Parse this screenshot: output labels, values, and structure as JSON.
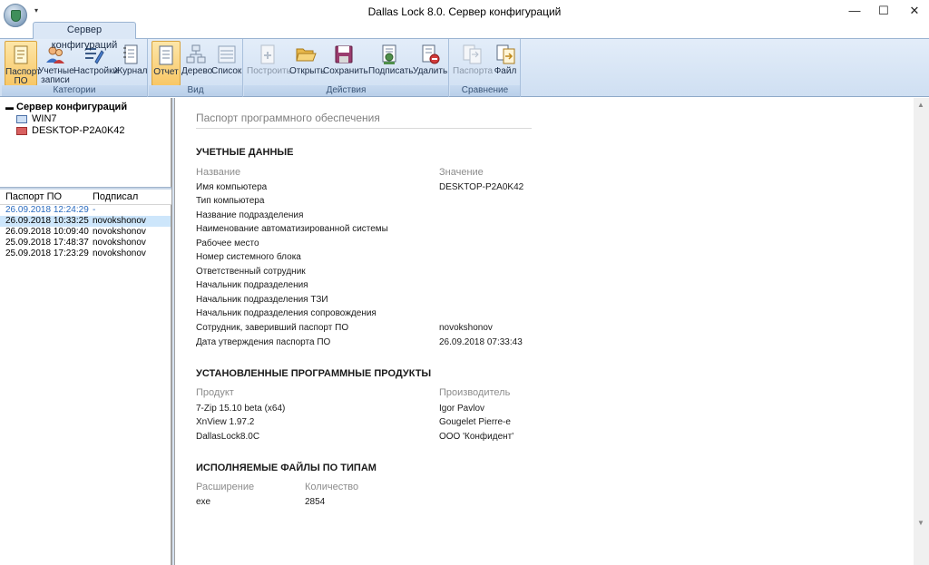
{
  "window": {
    "title": "Dallas Lock 8.0. Сервер конфигураций",
    "minimize": "—",
    "maximize": "☐",
    "close": "✕",
    "quick_access": "▾"
  },
  "ribbon": {
    "tab": "Сервер конфигураций",
    "groups": {
      "categories": {
        "label": "Категории",
        "passport": "Паспорт ПО",
        "accounts": "Учетные записи",
        "settings": "Настройки",
        "journal": "Журнал"
      },
      "view": {
        "label": "Вид",
        "report": "Отчет",
        "tree": "Дерево",
        "list": "Список"
      },
      "actions": {
        "label": "Действия",
        "build": "Построить",
        "open": "Открыть",
        "save": "Сохранить",
        "sign": "Подписать",
        "delete": "Удалить"
      },
      "compare": {
        "label": "Сравнение",
        "passport": "Паспорта",
        "file": "Файл"
      }
    }
  },
  "tree": {
    "root": "Сервер конфигураций",
    "items": [
      "WIN7",
      "DESKTOP-P2A0K42"
    ]
  },
  "passports": {
    "columns": [
      "Паспорт ПО",
      "Подписал"
    ],
    "rows": [
      {
        "date": "26.09.2018 12:24:29",
        "signer": "-"
      },
      {
        "date": "26.09.2018 10:33:25",
        "signer": "novokshonov"
      },
      {
        "date": "26.09.2018 10:09:40",
        "signer": "novokshonov"
      },
      {
        "date": "25.09.2018 17:48:37",
        "signer": "novokshonov"
      },
      {
        "date": "25.09.2018 17:23:29",
        "signer": "novokshonov"
      }
    ]
  },
  "report": {
    "title": "Паспорт программного обеспечения",
    "credentials": {
      "heading": "УЧЕТНЫЕ ДАННЫЕ",
      "col_name": "Название",
      "col_value": "Значение",
      "rows": [
        {
          "name": "Имя компьютера",
          "value": "DESKTOP-P2A0K42"
        },
        {
          "name": "Тип компьютера",
          "value": ""
        },
        {
          "name": "Название подразделения",
          "value": ""
        },
        {
          "name": "Наименование автоматизированной системы",
          "value": ""
        },
        {
          "name": "Рабочее место",
          "value": ""
        },
        {
          "name": "Номер системного блока",
          "value": ""
        },
        {
          "name": "Ответственный сотрудник",
          "value": ""
        },
        {
          "name": "Начальник подразделения",
          "value": ""
        },
        {
          "name": "Начальник подразделения ТЗИ",
          "value": ""
        },
        {
          "name": "Начальник подразделения сопровождения",
          "value": ""
        },
        {
          "name": "Сотрудник, заверивший паспорт ПО",
          "value": "novokshonov"
        },
        {
          "name": "Дата утверждения паспорта ПО",
          "value": "26.09.2018 07:33:43"
        }
      ]
    },
    "software": {
      "heading": "УСТАНОВЛЕННЫЕ ПРОГРАММНЫЕ ПРОДУКТЫ",
      "col_product": "Продукт",
      "col_vendor": "Производитель",
      "rows": [
        {
          "product": "7-Zip 15.10 beta (x64)",
          "vendor": "Igor Pavlov"
        },
        {
          "product": "XnView 1.97.2",
          "vendor": "Gougelet Pierre-e"
        },
        {
          "product": "DallasLock8.0C",
          "vendor": "ООО 'Конфидент'"
        }
      ]
    },
    "executables": {
      "heading": "ИСПОЛНЯЕМЫЕ ФАЙЛЫ ПО ТИПАМ",
      "col_ext": "Расширение",
      "col_count": "Количество",
      "rows": [
        {
          "ext": "exe",
          "count": "2854"
        }
      ]
    }
  }
}
